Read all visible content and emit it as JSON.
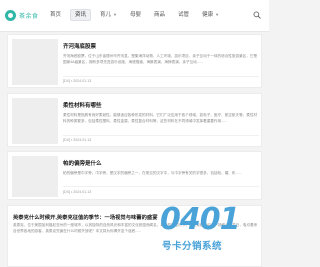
{
  "site": {
    "logo_text": "茶余食",
    "brand_color": "#2fb6a6"
  },
  "nav": {
    "items": [
      {
        "label": "首页",
        "active": false
      },
      {
        "label": "资讯",
        "active": true
      },
      {
        "label": "育儿",
        "active": false,
        "has_dropdown": true
      },
      {
        "label": "母婴",
        "active": false
      },
      {
        "label": "商品",
        "active": false
      },
      {
        "label": "试管",
        "active": false
      },
      {
        "label": "健康",
        "active": false,
        "has_dropdown": true
      }
    ],
    "search_icon": "search-icon"
  },
  "articles": [
    {
      "title": "齐河海底股票",
      "desc": "齐河海底股票，位于山东省德州市齐河县，是集海洋动物、人工环境、游乐项目、亲子互动于一体的综合性旅游景区，它是国家4A级景区，拥有多项先进游乐设施，海底隧道，海豚表演，海狮表演，亲子互动......",
      "meta": "[DX] • 2024.01.13"
    },
    {
      "title": "柔性材料有哪些",
      "desc": "柔性材料是指具有良好柔韧性，能够适应各种形变的材料，它们广泛应用于各个领域，如电子、医疗、航空航天等。柔性材料的种类繁多，包括柔性塑料、柔性金属、柔性复合材料等，这些材料在不同领域中发挥着重要作用......",
      "meta": "[DX] • 2024.01.13"
    },
    {
      "title": "帕的偏旁是什么",
      "desc": "帕的偏旁是巾字旁。巾字旁，是汉字的偏旁之一，在常见的汉字中，与巾字旁有关的字很多，包括帕、帽、布......",
      "meta": "[DX] • 2024.01.13"
    },
    {
      "title": "英泰克什么时候开,英泰克征值的季节：一场视觉与味蕾的盛宴",
      "desc": "英泰克，位于美国加利福尼亚州的一座城市，以其独特的自然风光和丰富的文化底蕴而闻名，每年的特定时节，英泰克都会迎来一场盛大的节日，吸引着来自世界各地的游客，英泰克究竟在什么时候开放呢？本文将为你揭开这个谜底......",
      "meta": ""
    }
  ],
  "watermark": {
    "number": "0401",
    "subtitle": "号卡分销系统"
  }
}
